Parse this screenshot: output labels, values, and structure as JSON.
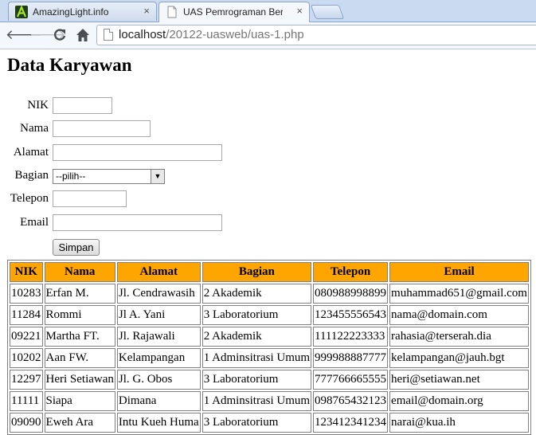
{
  "browser": {
    "tabs": [
      {
        "title": "AmazingLight.info",
        "active": false,
        "icon": "amazinglight-favicon"
      },
      {
        "title": "UAS Pemrograman Berbas",
        "active": true,
        "icon": "page-favicon"
      }
    ],
    "close_glyph": "×",
    "address": {
      "host": "localhost",
      "path": "/20122-uasweb/uas-1.php"
    }
  },
  "page": {
    "heading": "Data Karyawan",
    "form": {
      "nik_label": "NIK",
      "nama_label": "Nama",
      "alamat_label": "Alamat",
      "bagian_label": "Bagian",
      "bagian_selected": "--pilih--",
      "telepon_label": "Telepon",
      "email_label": "Email",
      "submit_label": "Simpan"
    },
    "table": {
      "header_color": "#ffa500",
      "columns": [
        "NIK",
        "Nama",
        "Alamat",
        "Bagian",
        "Telepon",
        "Email"
      ],
      "rows": [
        [
          "10283",
          "Erfan M.",
          "Jl. Cendrawasih",
          "2 Akademik",
          "080988998899",
          "muhammad651@gmail.com"
        ],
        [
          "11284",
          "Rommi",
          "Jl A. Yani",
          "3 Laboratorium",
          "123455556543",
          "nama@domain.com"
        ],
        [
          "09221",
          "Martha FT.",
          "Jl. Rajawali",
          "2 Akademik",
          "111122223333",
          "rahasia@terserah.dia"
        ],
        [
          "10202",
          "Aan FW.",
          "Kelampangan",
          "1 Adminsitrasi Umum",
          "999988887777",
          "kelampangan@jauh.bgt"
        ],
        [
          "12297",
          "Heri Setiawan",
          "Jl. G. Obos",
          "3 Laboratorium",
          "777766665555",
          "heri@setiawan.net"
        ],
        [
          "11111",
          "Siapa",
          "Dimana",
          "1 Adminsitrasi Umum",
          "098765432123",
          "email@domain.org"
        ],
        [
          "09090",
          "Eweh Ara",
          "Intu Kueh Huma",
          "3 Laboratorium",
          "123412341234",
          "narai@kua.ih"
        ]
      ]
    }
  }
}
